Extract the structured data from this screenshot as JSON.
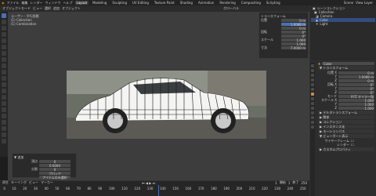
{
  "menus": [
    "ファイル",
    "編集",
    "レンダー",
    "ウィンドウ",
    "ヘルプ"
  ],
  "workspace_tabs": [
    {
      "label": "Layout",
      "active": true
    },
    {
      "label": "Modeling",
      "active": false
    },
    {
      "label": "Sculpting",
      "active": false
    },
    {
      "label": "UV Editing",
      "active": false
    },
    {
      "label": "Texture Paint",
      "active": false
    },
    {
      "label": "Shading",
      "active": false
    },
    {
      "label": "Animation",
      "active": false
    },
    {
      "label": "Rendering",
      "active": false
    },
    {
      "label": "Compositing",
      "active": false
    },
    {
      "label": "Scripting",
      "active": false
    }
  ],
  "scene": {
    "name": "Scene",
    "layer": "View Layer"
  },
  "viewport_header": [
    "オブジェクトモード",
    "ビュー",
    "選択",
    "追加",
    "オブジェクト",
    "グローバル"
  ],
  "viewport_overlay_text": {
    "line1": "ユーザー・平行投影",
    "line2": "(1) Collection",
    "line3": "(1) Combination"
  },
  "npanel": {
    "title": "トランスフォーム",
    "rows": [
      {
        "label": "位置",
        "value": "0 m"
      },
      {
        "label": "",
        "value": "1.0088 m"
      },
      {
        "label": "",
        "value": "0 m"
      },
      {
        "label": "回転",
        "value": "0°"
      },
      {
        "label": "",
        "value": "0°"
      },
      {
        "label": "スケール",
        "value": "1.000"
      },
      {
        "label": "",
        "value": "1.000"
      },
      {
        "label": "寸法",
        "value": "7.0000 m"
      }
    ]
  },
  "operator_panel": {
    "title": "▼ 追加",
    "rows": [
      {
        "label": "頂点",
        "value": "0"
      },
      {
        "label": "",
        "value": "0.0000"
      },
      {
        "label": "分割",
        "value": "0"
      },
      {
        "label": "",
        "value": "ブロック"
      },
      {
        "label": "",
        "value": "アイテムのみ選択"
      }
    ]
  },
  "timeline": {
    "menus": [
      "再生",
      "キーイング",
      "ビュー",
      "マーカー"
    ],
    "ticks": [
      "0",
      "10",
      "20",
      "30",
      "40",
      "50",
      "60",
      "70",
      "80",
      "90",
      "100",
      "110",
      "120",
      "130",
      "140",
      "150",
      "160",
      "170",
      "180",
      "190",
      "200",
      "210",
      "220",
      "230",
      "240",
      "250"
    ],
    "current_frame": "1",
    "start": "1",
    "end": "250"
  },
  "outliner": {
    "items": [
      {
        "label": "シーンコレクション",
        "selected": false
      },
      {
        "label": "Collection",
        "selected": false
      },
      {
        "label": "Camera",
        "selected": false
      },
      {
        "label": "Cube",
        "selected": true
      },
      {
        "label": "Light",
        "selected": false
      }
    ]
  },
  "properties": {
    "object_name": "Cube",
    "sections": [
      {
        "title": "▼ トランスフォーム"
      },
      {
        "label": "位置 X",
        "value": "0 m"
      },
      {
        "label": "Y",
        "value": "1.0088 m"
      },
      {
        "label": "Z",
        "value": "0 m"
      },
      {
        "label": "回転 X",
        "value": "0°"
      },
      {
        "label": "Y",
        "value": "0°"
      },
      {
        "label": "Z",
        "value": "0°"
      },
      {
        "label": "モード",
        "value": "XYZ オイラー角"
      },
      {
        "label": "スケール X",
        "value": "1.000"
      },
      {
        "label": "Y",
        "value": "1.000"
      },
      {
        "label": "Z",
        "value": "1.000"
      },
      {
        "title": "▶ デルタトランスフォーム"
      },
      {
        "title": "▶ 関係"
      },
      {
        "title": "▶ コレクション"
      },
      {
        "title": "▶ インスタンス化"
      },
      {
        "title": "▶ モーションパス"
      },
      {
        "title": "▼ ビューポート表示"
      },
      {
        "label": "ワイヤーフレーム",
        "value": ""
      },
      {
        "label": "レンダー",
        "value": ""
      },
      {
        "title": "▶ カスタムプロパティ"
      }
    ]
  },
  "status_bar": {
    "frame_label": "フレーム",
    "start_label": "開始",
    "end_label": "終了"
  },
  "colors": {
    "accent": "#4772b3",
    "selection": "#334d80",
    "active_prop": "#d18a3a"
  }
}
